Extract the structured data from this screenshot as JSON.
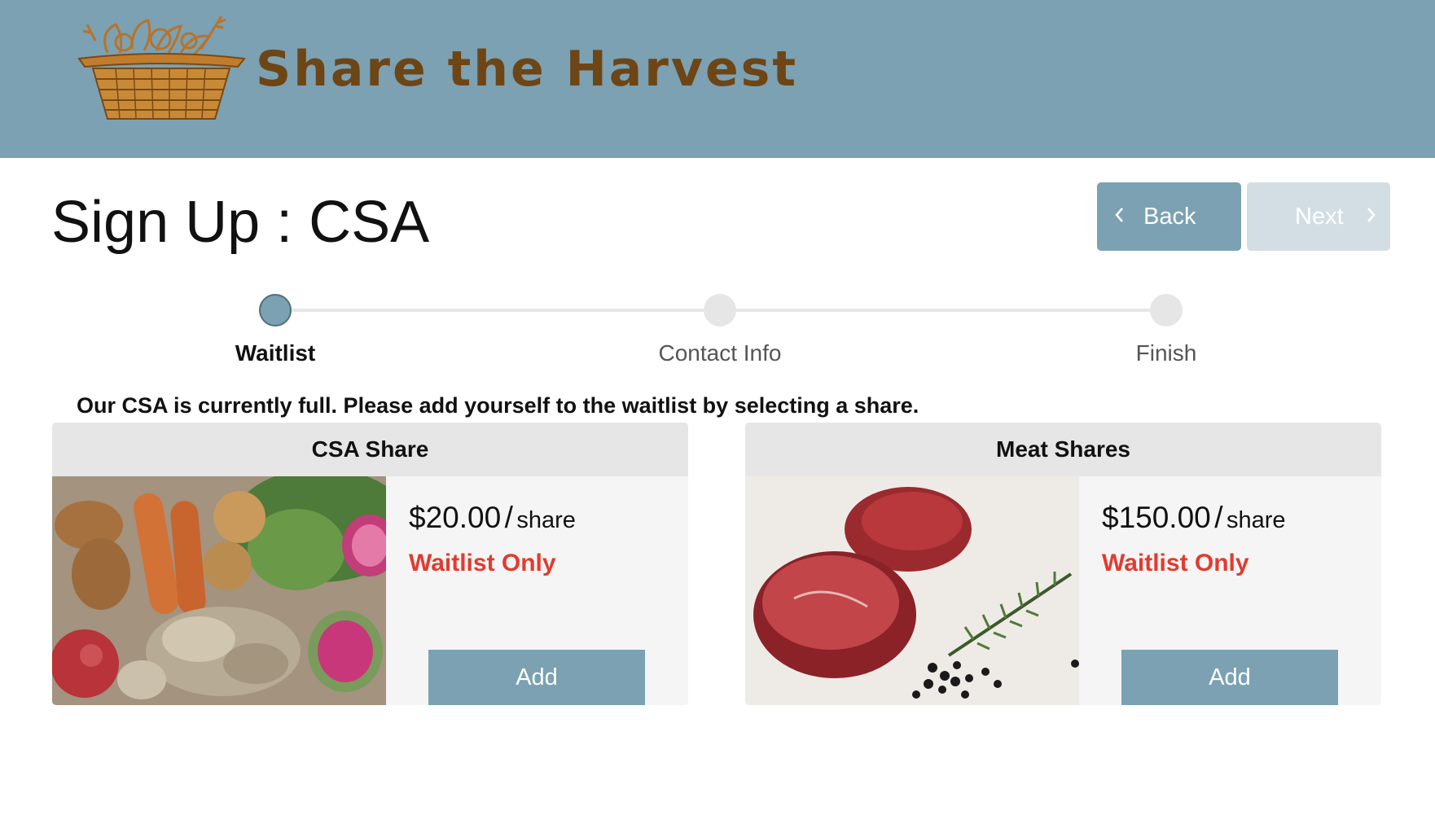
{
  "header": {
    "brand_name": "Share the Harvest",
    "logo_icon": "harvest-basket-logo",
    "background_color": "#7ba1b3",
    "brand_color": "#6e4515"
  },
  "page": {
    "title": "Sign Up : CSA"
  },
  "nav": {
    "back_label": "Back",
    "next_label": "Next",
    "back_icon": "chevron-left-icon",
    "next_icon": "chevron-right-icon",
    "next_enabled": false
  },
  "steps": [
    {
      "label": "Waitlist",
      "active": true
    },
    {
      "label": "Contact Info",
      "active": false
    },
    {
      "label": "Finish",
      "active": false
    }
  ],
  "notice": "Our CSA is currently full. Please add yourself to the waitlist by selecting a share.",
  "shares": [
    {
      "title": "CSA Share",
      "price": "$20.00",
      "separator": "/",
      "unit": "share",
      "status": "Waitlist Only",
      "add_label": "Add",
      "image": "vegetables-photo"
    },
    {
      "title": "Meat Shares",
      "price": "$150.00",
      "separator": "/",
      "unit": "share",
      "status": "Waitlist Only",
      "add_label": "Add",
      "image": "beef-steak-photo"
    }
  ],
  "colors": {
    "accent": "#7ba1b3",
    "accent_disabled": "#d3dee4",
    "status_red": "#e23b2e",
    "card_bg": "#f5f5f5",
    "card_header_bg": "#e6e6e6"
  }
}
